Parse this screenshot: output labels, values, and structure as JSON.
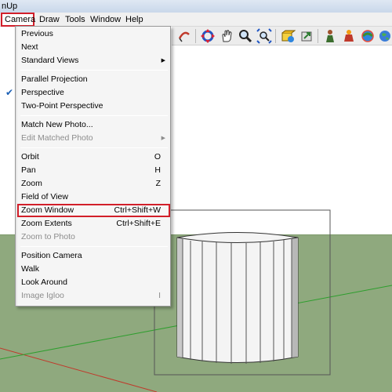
{
  "titlebar": {
    "text": "nUp"
  },
  "menubar": {
    "items": [
      "Camera",
      "Draw",
      "Tools",
      "Window",
      "Help"
    ]
  },
  "camera_menu": {
    "items": [
      {
        "label": "Previous"
      },
      {
        "label": "Next"
      },
      {
        "label": "Standard Views"
      },
      {
        "label": "Parallel Projection"
      },
      {
        "label": "Perspective"
      },
      {
        "label": "Two-Point Perspective"
      },
      {
        "label": "Match New Photo..."
      },
      {
        "label": "Edit Matched Photo"
      },
      {
        "label": "Orbit",
        "shortcut": "O"
      },
      {
        "label": "Pan",
        "shortcut": "H"
      },
      {
        "label": "Zoom",
        "shortcut": "Z"
      },
      {
        "label": "Field of View"
      },
      {
        "label": "Zoom Window",
        "shortcut": "Ctrl+Shift+W"
      },
      {
        "label": "Zoom Extents",
        "shortcut": "Ctrl+Shift+E"
      },
      {
        "label": "Zoom to Photo"
      },
      {
        "label": "Position Camera"
      },
      {
        "label": "Walk"
      },
      {
        "label": "Look Around"
      },
      {
        "label": "Image Igloo",
        "shortcut": "I"
      }
    ],
    "checked_item": "Perspective",
    "highlighted_item": "Zoom Window",
    "disabled_items": [
      "Edit Matched Photo",
      "Zoom to Photo",
      "Image Igloo"
    ]
  },
  "toolbar": {
    "icons": [
      "lasso-icon",
      "orbit-icon",
      "pan-icon",
      "zoom-icon",
      "zoom-extents-icon",
      "get-models-icon",
      "share-model-icon",
      "components-icon",
      "extension-warehouse-icon",
      "geo-location-icon",
      "earth-icon"
    ]
  },
  "colors": {
    "highlight_box": "#d21f2a",
    "ground": "#8fa97e",
    "sky": "#ffffff",
    "red_axis": "#c0392b",
    "green_axis": "#2e9e2e"
  }
}
